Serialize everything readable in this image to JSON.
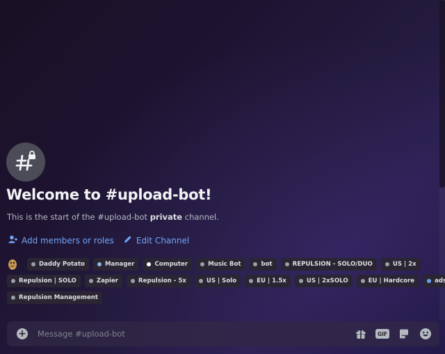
{
  "welcome": {
    "title": "Welcome to #upload-bot!",
    "sub_prefix": "This is the start of the #upload-bot ",
    "sub_bold": "private",
    "sub_suffix": " channel."
  },
  "actions": {
    "add_members": "Add members or roles",
    "edit_channel": "Edit Channel"
  },
  "roles": [
    [
      {
        "label": "Daddy Potato",
        "color": "#99a0aa"
      },
      {
        "label": "Manager",
        "color": "#8fb4e8"
      },
      {
        "label": "Computer",
        "color": "#ffffff"
      },
      {
        "label": "Music Bot",
        "color": "#99a0aa"
      },
      {
        "label": "bot",
        "color": "#99a0aa"
      },
      {
        "label": "REPULSION - SOLO/DUO",
        "color": "#99a0aa"
      },
      {
        "label": "US | 2x",
        "color": "#99a0aa"
      }
    ],
    [
      {
        "label": "Repulsion | SOLO",
        "color": "#99a0aa"
      },
      {
        "label": "Zapier",
        "color": "#99a0aa"
      },
      {
        "label": "Repulsion - 5x",
        "color": "#99a0aa"
      },
      {
        "label": "US | Solo",
        "color": "#99a0aa"
      },
      {
        "label": "EU | 1.5x",
        "color": "#99a0aa"
      },
      {
        "label": "US | 2xSOLO",
        "color": "#99a0aa"
      },
      {
        "label": "EU | Hardcore",
        "color": "#99a0aa"
      },
      {
        "label": "ads role",
        "color": "#6aa2f0"
      }
    ],
    [
      {
        "label": "Repulsion Management",
        "color": "#99a0aa"
      }
    ]
  ],
  "composer": {
    "placeholder": "Message #upload-bot",
    "gif_label": "GIF"
  },
  "icons": {
    "channel": "hashtag-lock-icon",
    "add_members": "person-add-icon",
    "edit": "pencil-icon",
    "avatar": "potato-avatar",
    "plus": "plus-circle-icon",
    "gift": "gift-icon",
    "gif": "gif-icon",
    "sticker": "sticker-icon",
    "emoji": "emoji-icon"
  }
}
